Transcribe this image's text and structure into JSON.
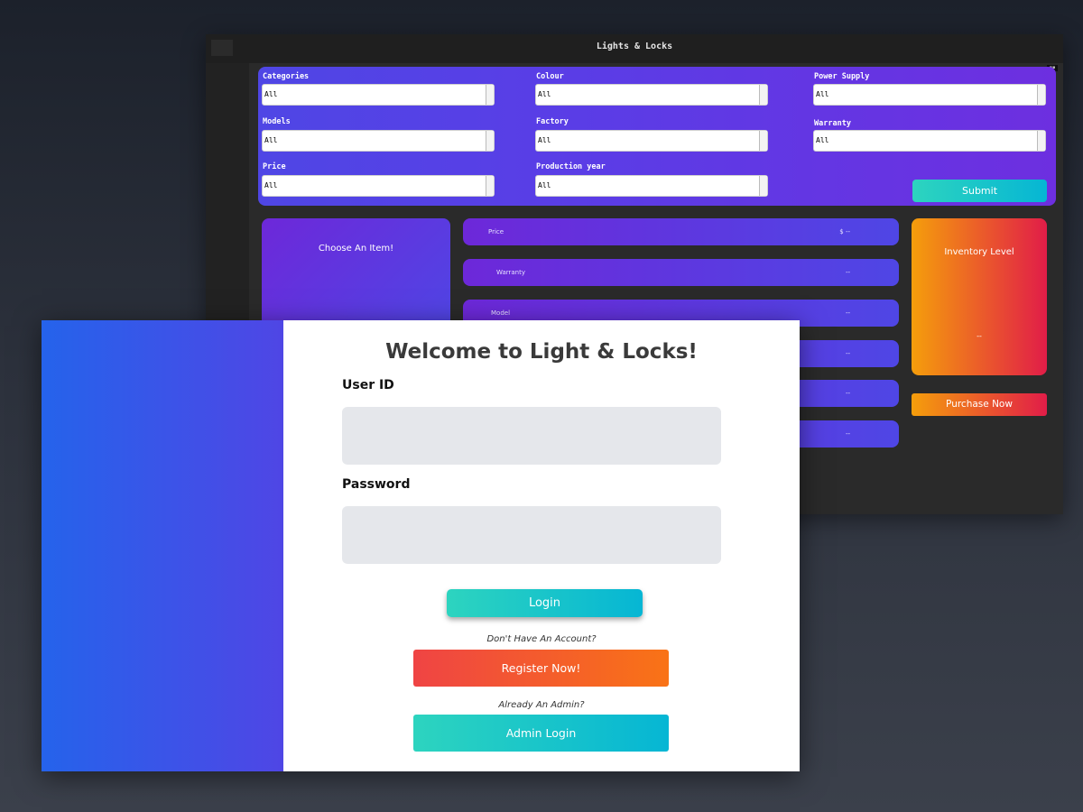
{
  "back_window": {
    "title": "Lights & Locks",
    "filters": [
      {
        "label": "Categories",
        "value": "All"
      },
      {
        "label": "Colour",
        "value": "All"
      },
      {
        "label": "Power Supply",
        "value": "All"
      },
      {
        "label": "Models",
        "value": "All"
      },
      {
        "label": "Factory",
        "value": "All"
      },
      {
        "label": "Warranty",
        "value": "All"
      },
      {
        "label": "Price",
        "value": "All"
      },
      {
        "label": "Production year",
        "value": "All"
      }
    ],
    "submit_label": "Submit",
    "choose_item_text": "Choose An Item!",
    "specs": [
      {
        "label": "Price",
        "value": "$ --"
      },
      {
        "label": "Warranty",
        "value": "--"
      },
      {
        "label": "Model",
        "value": "--"
      },
      {
        "label": "",
        "value": "--"
      },
      {
        "label": "",
        "value": "--"
      },
      {
        "label": "",
        "value": "--"
      }
    ],
    "inventory": {
      "title": "Inventory Level",
      "value": "--"
    },
    "purchase_label": "Purchase Now"
  },
  "login_window": {
    "title": "Welcome to Light & Locks!",
    "user_id_label": "User ID",
    "user_id_value": "",
    "password_label": "Password",
    "password_value": "",
    "login_label": "Login",
    "no_account_text": "Don't Have An Account?",
    "register_label": "Register Now!",
    "admin_hint_text": "Already An Admin?",
    "admin_login_label": "Admin Login"
  },
  "colors": {
    "panel_purple": "#4f46e5",
    "teal": "#2dd4bf",
    "orange": "#f59e0b",
    "red": "#ef4444",
    "blue": "#2563eb"
  }
}
